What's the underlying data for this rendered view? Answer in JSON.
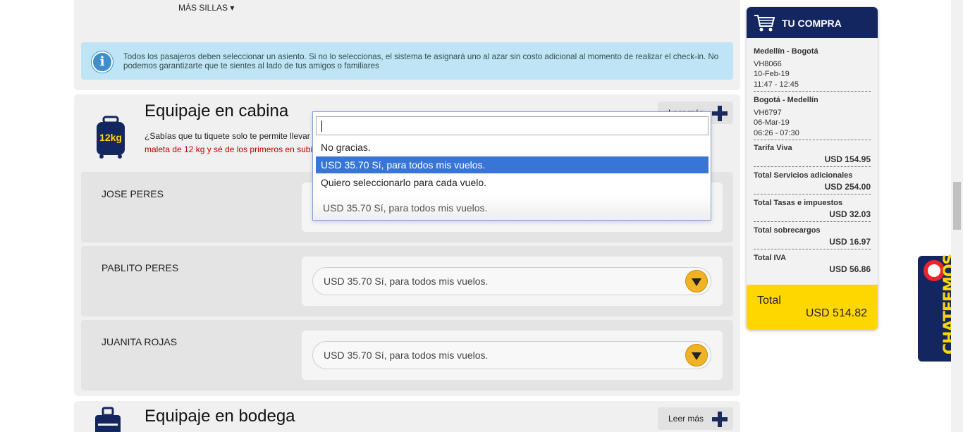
{
  "seats": {
    "more_seats_label": "MÁS SILLAS ▾",
    "info_text": "Todos los pasajeros deben seleccionar un asiento. Si no lo seleccionas, el sistema te asignará uno al azar sin costo adicional al momento de realizar el check-in. No podemos garantizarte que te sientes al lado de tus amigos o familiares"
  },
  "cabin": {
    "title": "Equipaje en cabina",
    "leer_mas": "Leer más",
    "desc_line1": "¿Sabías que tu tiquete solo te permite llevar",
    "desc_line2": "maleta de 12 kg y sé de los primeros en subi",
    "bag_label": "12kg",
    "passengers": [
      {
        "name": "JOSE PERES",
        "selected": "USD 35.70 Sí, para todos mis vuelos."
      },
      {
        "name": "PABLITO PERES",
        "selected": "USD 35.70 Sí, para todos mis vuelos."
      },
      {
        "name": "JUANITA ROJAS",
        "selected": "USD 35.70 Sí, para todos mis vuelos."
      }
    ]
  },
  "dropdown": {
    "search_value": "",
    "options": [
      "No gracias.",
      "USD 35.70 Sí, para todos mis vuelos.",
      "Quiero seleccionarlo para cada vuelo."
    ],
    "highlighted_index": 1,
    "current_value": "USD 35.70 Sí, para todos mis vuelos."
  },
  "bodega": {
    "title": "Equipaje en bodega",
    "leer_mas": "Leer más"
  },
  "cart": {
    "title": "TU COMPRA",
    "flights": [
      {
        "route": "Medellín - Bogotá",
        "code": "VH8066",
        "date": "10-Feb-19",
        "time": "11:47 - 12:45"
      },
      {
        "route": "Bogotá - Medellín",
        "code": "VH6797",
        "date": "06-Mar-19",
        "time": "06:26 - 07:30"
      }
    ],
    "summary": [
      {
        "label": "Tarifa Viva",
        "amount": "USD 154.95"
      },
      {
        "label": "Total Servicios adicionales",
        "amount": "USD 254.00"
      },
      {
        "label": "Total Tasas e impuestos",
        "amount": "USD 32.03"
      },
      {
        "label": "Total sobrecargos",
        "amount": "USD 16.97"
      },
      {
        "label": "Total IVA",
        "amount": "USD 56.86"
      }
    ],
    "total_label": "Total",
    "total_amount": "USD 514.82"
  },
  "chat": {
    "label": "CHATEEMOS"
  },
  "colors": {
    "brand_navy": "#142660",
    "brand_yellow": "#ffd700",
    "selection_blue": "#3875d7",
    "info_bg": "#bfe4f5"
  }
}
